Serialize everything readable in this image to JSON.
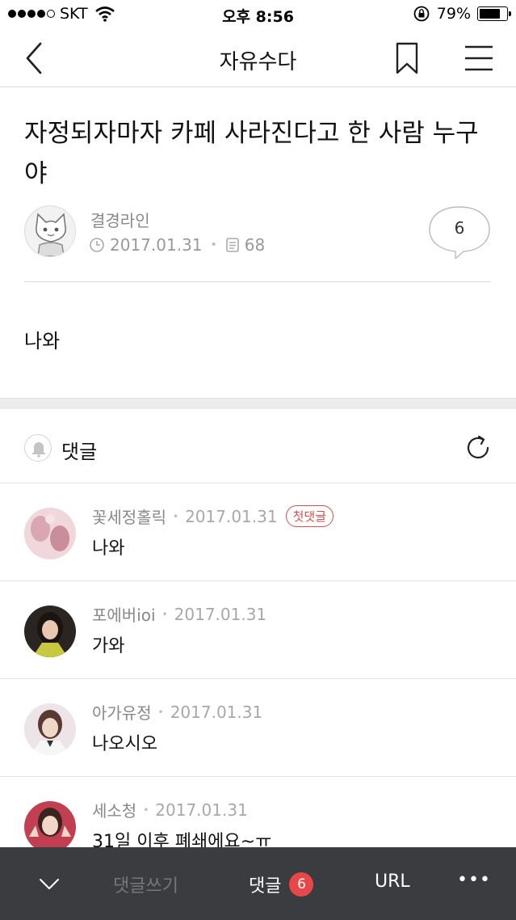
{
  "status_bar": {
    "carrier": "SKT",
    "time": "오후 8:56",
    "battery": "79%",
    "battery_level": 0.79
  },
  "nav": {
    "title": "자유수다"
  },
  "post": {
    "title": "자정되자마자 카페 사라진다고 한 사람 누구야",
    "author": "결경라인",
    "date": "2017.01.31",
    "views": "68",
    "comment_count": "6",
    "body": "나와"
  },
  "comments_section": {
    "label": "댓글",
    "items": [
      {
        "author": "꽃세정홀릭",
        "date": "2017.01.31",
        "badge": "첫댓글",
        "text": "나와",
        "avatar_color": "#e9c6cf"
      },
      {
        "author": "포에버ioi",
        "date": "2017.01.31",
        "text": "가와",
        "avatar_color": "#2a2422"
      },
      {
        "author": "아가유정",
        "date": "2017.01.31",
        "text": "나오시오",
        "avatar_color": "#ddd0d0"
      },
      {
        "author": "세소청",
        "date": "2017.01.31",
        "text": "31일 이후 폐쇄에요~ㅠ",
        "avatar_color": "#c23f52"
      }
    ]
  },
  "toolbar": {
    "write_label": "댓글쓰기",
    "comments_label": "댓글",
    "comments_count": "6",
    "url_label": "URL",
    "more_label": "•••"
  }
}
